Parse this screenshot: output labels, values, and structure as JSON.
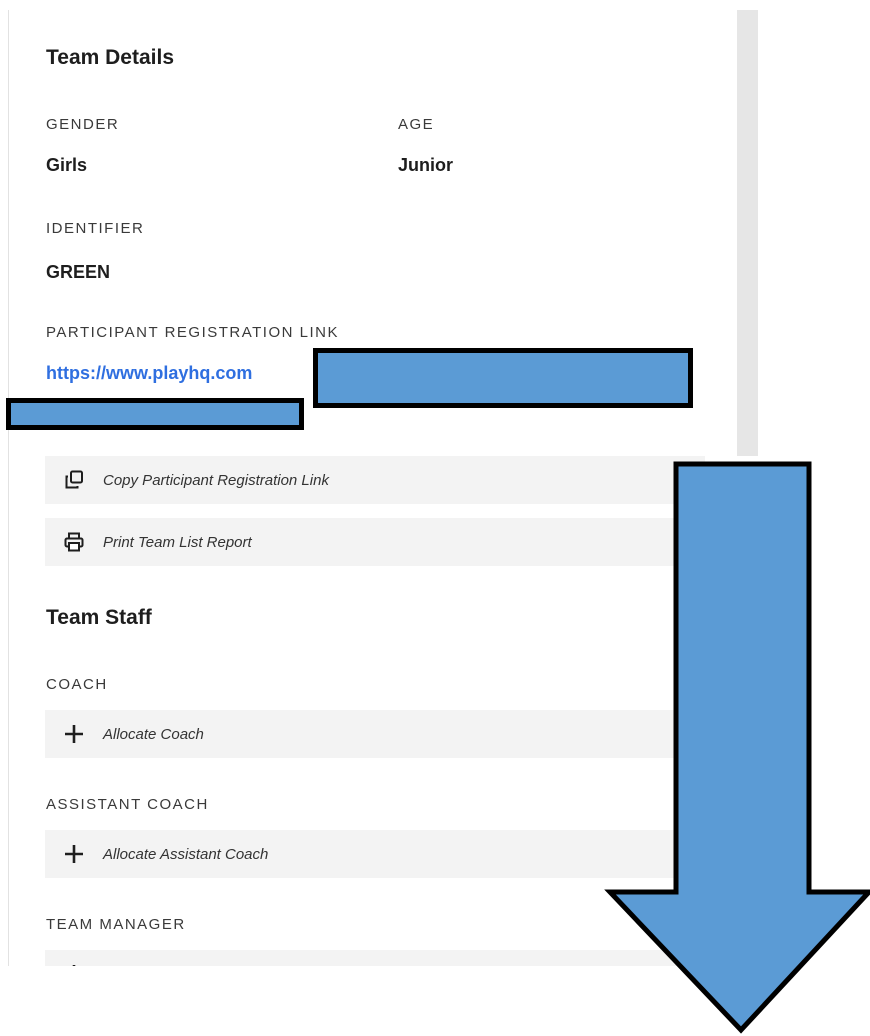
{
  "team_details": {
    "title": "Team Details",
    "gender_label": "GENDER",
    "gender_value": "Girls",
    "age_label": "AGE",
    "age_value": "Junior",
    "identifier_label": "IDENTIFIER",
    "identifier_value": "GREEN",
    "registration_label": "PARTICIPANT REGISTRATION LINK",
    "registration_link": "https://www.playhq.com"
  },
  "actions": {
    "copy_link_label": "Copy Participant Registration Link",
    "print_report_label": "Print Team List Report"
  },
  "team_staff": {
    "title": "Team Staff",
    "coach_label": "COACH",
    "coach_action": "Allocate Coach",
    "assistant_label": "ASSISTANT COACH",
    "assistant_action": "Allocate Assistant Coach",
    "manager_label": "TEAM MANAGER"
  },
  "icons": {
    "copy": "copy-icon",
    "print": "printer-icon",
    "add": "plus-icon"
  },
  "colors": {
    "link": "#2f6fe0",
    "redaction_fill": "#5b9bd5",
    "redaction_border": "#000000",
    "row_background": "#f3f3f3"
  }
}
